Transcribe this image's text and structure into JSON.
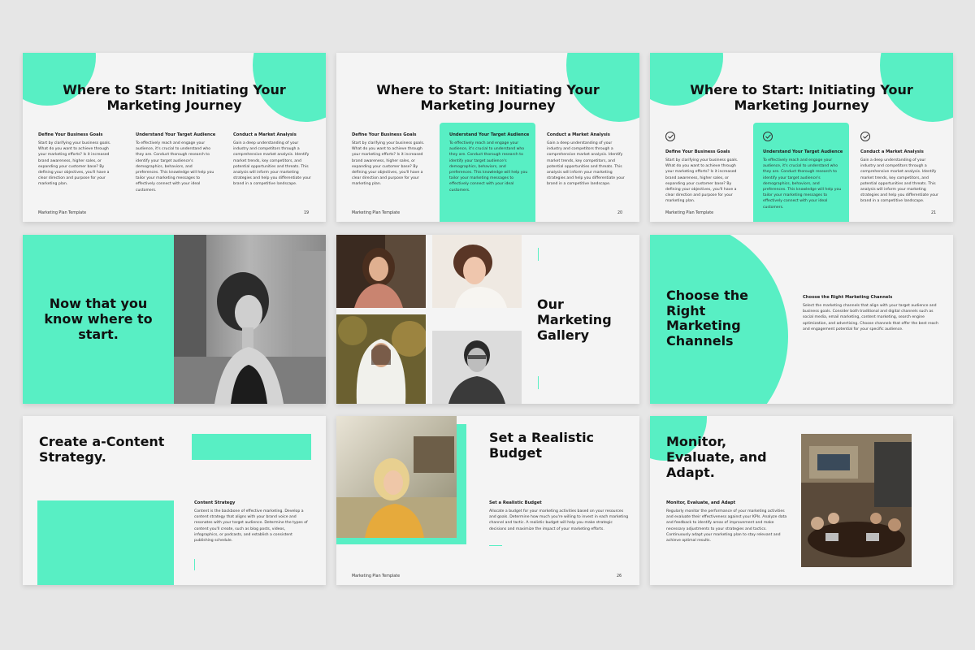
{
  "slides_19_21": {
    "title": "Where to Start: Initiating Your Marketing Journey",
    "col1_heading": "Define Your Business Goals",
    "col1_body": "Start by clarifying your business goals. What do you want to achieve through your marketing efforts? Is it increased brand awareness, higher sales, or expanding your customer base? By defining your objectives, you'll have a clear direction and purpose for your marketing plan.",
    "col2_heading": "Understand Your Target Audience",
    "col2_body": "To effectively reach and engage your audience, it's crucial to understand who they are. Conduct thorough research to identify your target audience's demographics, behaviors, and preferences. This knowledge will help you tailor your marketing messages to effectively connect with your ideal customers.",
    "col3_heading": "Conduct a Market Analysis",
    "col3_body": "Gain a deep understanding of your industry and competitors through a comprehensive market analysis. Identify market trends, key competitors, and potential opportunities and threats. This analysis will inform your marketing strategies and help you differentiate your brand in a competitive landscape.",
    "footer": "Marketing Plan Template",
    "page_19": "19",
    "page_20": "20",
    "page_21": "21"
  },
  "slide_now": {
    "title": "Now that you know where to start."
  },
  "slide_gallery": {
    "title": "Our Marketing Gallery"
  },
  "slide_channels": {
    "title": "Choose the Right Marketing Channels",
    "heading": "Choose the Right Marketing Channels",
    "body": "Select the marketing channels that align with your target audience and business goals. Consider both traditional and digital channels such as social media, email marketing, content marketing, search engine optimization, and advertising. Choose channels that offer the best reach and engagement potential for your specific audience."
  },
  "slide_content": {
    "title": "Create a-Content Strategy.",
    "heading": "Content Strategy",
    "body": "Content is the backbone of effective marketing. Develop a content strategy that aligns with your brand voice and resonates with your target audience. Determine the types of content you'll create, such as blog posts, videos, infographics, or podcasts, and establish a consistent publishing schedule."
  },
  "slide_budget": {
    "title": "Set a Realistic Budget",
    "heading": "Set a Realistic Budget",
    "body": "Allocate a budget for your marketing activities based on your resources and goals. Determine how much you're willing to invest in each marketing channel and tactic. A realistic budget will help you make strategic decisions and maximize the impact of your marketing efforts.",
    "footer": "Marketing Plan Template",
    "page": "26"
  },
  "slide_monitor": {
    "title": "Monitor, Evaluate, and Adapt.",
    "heading": "Monitor, Evaluate, and Adapt",
    "body": "Regularly monitor the performance of your marketing activities and evaluate their effectiveness against your KPIs. Analyze data and feedback to identify areas of improvement and make necessary adjustments to your strategies and tactics. Continuously adapt your marketing plan to stay relevant and achieve optimal results."
  },
  "colors": {
    "accent": "#58efc4",
    "slide_bg": "#f4f4f4",
    "page_bg": "#e6e6e6"
  }
}
